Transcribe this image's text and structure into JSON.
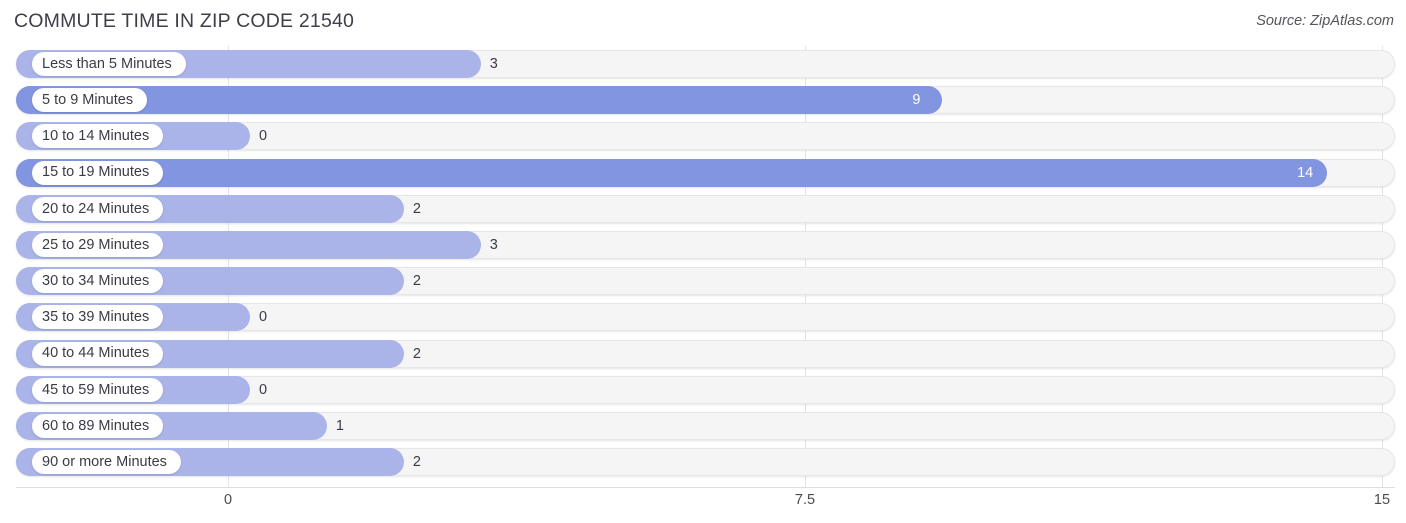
{
  "header": {
    "title": "COMMUTE TIME IN ZIP CODE 21540",
    "source": "Source: ZipAtlas.com"
  },
  "colors": {
    "bar_light": "#aab4e8",
    "bar_dark": "#8295e0",
    "track": "#f5f5f6",
    "grid": "#e3e3e6",
    "text": "#3b3b47"
  },
  "chart_data": {
    "type": "bar",
    "orientation": "horizontal",
    "title": "COMMUTE TIME IN ZIP CODE 21540",
    "xlabel": "",
    "ylabel": "",
    "xlim": [
      0,
      15
    ],
    "ticks": [
      "0",
      "7.5",
      "15"
    ],
    "tick_values": [
      0,
      7.5,
      15
    ],
    "grid": true,
    "legend": null,
    "categories": [
      "Less than 5 Minutes",
      "5 to 9 Minutes",
      "10 to 14 Minutes",
      "15 to 19 Minutes",
      "20 to 24 Minutes",
      "25 to 29 Minutes",
      "30 to 34 Minutes",
      "35 to 39 Minutes",
      "40 to 44 Minutes",
      "45 to 59 Minutes",
      "60 to 89 Minutes",
      "90 or more Minutes"
    ],
    "values": [
      3,
      9,
      0,
      14,
      2,
      3,
      2,
      0,
      2,
      0,
      1,
      2
    ],
    "value_labels": [
      "3",
      "9",
      "0",
      "14",
      "2",
      "3",
      "2",
      "0",
      "2",
      "0",
      "1",
      "2"
    ]
  }
}
